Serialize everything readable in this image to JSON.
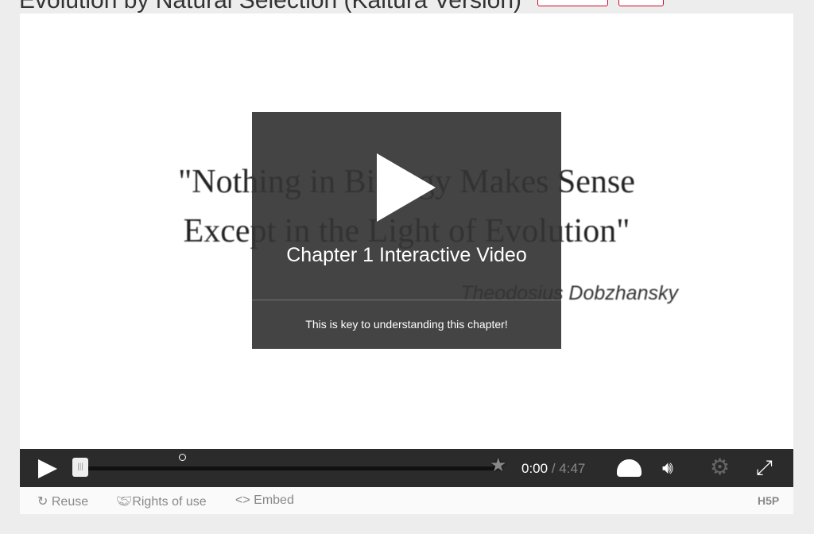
{
  "page": {
    "title": "Evolution by Natural Selection (Kaltura Version)"
  },
  "video": {
    "quote_line1": "\"Nothing in Biology Makes Sense",
    "quote_line2": "Except in the Light of Evolution\"",
    "author": "Theodosius Dobzhansky"
  },
  "overlay": {
    "title": "Chapter 1 Interactive Video",
    "description": "This is key to understanding this chapter!"
  },
  "controls": {
    "current_time": "0:00",
    "separator": "/",
    "total_time": "4:47",
    "progress": 0
  },
  "footer": {
    "reuse": "Reuse",
    "rights": "Rights of use",
    "embed": "Embed",
    "logo": "H5P"
  },
  "colors": {
    "accent": "#c8102e",
    "controls_bg": "#2b2b2b"
  }
}
